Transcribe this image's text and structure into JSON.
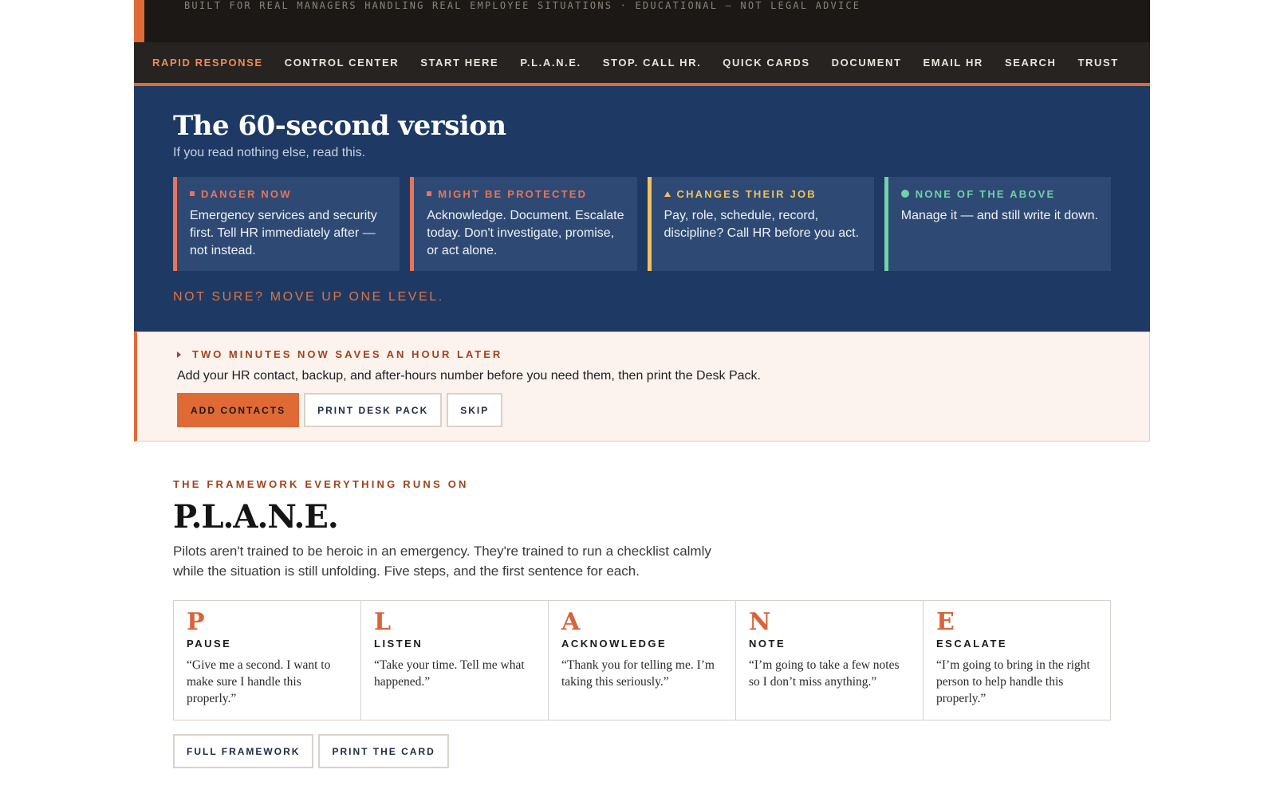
{
  "tagline": "BUILT FOR REAL MANAGERS HANDLING REAL EMPLOYEE SITUATIONS · EDUCATIONAL — NOT LEGAL ADVICE",
  "nav": {
    "items": [
      {
        "label": "RAPID RESPONSE",
        "active": true
      },
      {
        "label": "CONTROL CENTER"
      },
      {
        "label": "START HERE"
      },
      {
        "label": "P.L.A.N.E."
      },
      {
        "label": "STOP. CALL HR."
      },
      {
        "label": "QUICK CARDS"
      },
      {
        "label": "DOCUMENT"
      },
      {
        "label": "EMAIL HR"
      },
      {
        "label": "SEARCH"
      },
      {
        "label": "TRUST"
      }
    ]
  },
  "quick": {
    "title": "The 60-second version",
    "subtitle": "If you read nothing else, read this.",
    "cards": [
      {
        "label": "DANGER NOW",
        "body": "Emergency services and security first. Tell HR immediately after — not instead.",
        "color": "#e8745a",
        "marker": "square"
      },
      {
        "label": "MIGHT BE PROTECTED",
        "body": "Acknowledge. Document. Escalate today. Don't investigate, promise, or act alone.",
        "color": "#e8745a",
        "marker": "square"
      },
      {
        "label": "CHANGES THEIR JOB",
        "body": "Pay, role, schedule, record, discipline? Call HR before you act.",
        "color": "#f2c15e",
        "marker": "triangle"
      },
      {
        "label": "NONE OF THE ABOVE",
        "body": "Manage it — and still write it down.",
        "color": "#6fd3a6",
        "marker": "dot"
      }
    ],
    "footer": "NOT SURE? MOVE UP ONE LEVEL."
  },
  "callout": {
    "heading": "TWO MINUTES NOW SAVES AN HOUR LATER",
    "message": "Add your HR contact, backup, and after-hours number before you need them, then print the Desk Pack.",
    "buttons": {
      "add": "ADD CONTACTS",
      "print": "PRINT DESK PACK",
      "skip": "SKIP"
    }
  },
  "plane": {
    "eyebrow": "THE FRAMEWORK EVERYTHING RUNS ON",
    "title": "P.L.A.N.E.",
    "intro": "Pilots aren't trained to be heroic in an emergency. They're trained to run a checklist calmly while the situation is still unfolding. Five steps, and the first sentence for each.",
    "steps": [
      {
        "letter": "P",
        "word": "PAUSE",
        "quote": "“Give me a second. I want to make sure I handle this properly.”"
      },
      {
        "letter": "L",
        "word": "LISTEN",
        "quote": "“Take your time. Tell me what happened.”"
      },
      {
        "letter": "A",
        "word": "ACKNOWLEDGE",
        "quote": "“Thank you for telling me. I’m taking this seriously.”"
      },
      {
        "letter": "N",
        "word": "NOTE",
        "quote": "“I’m going to take a few notes so I don’t miss anything.”"
      },
      {
        "letter": "E",
        "word": "ESCALATE",
        "quote": "“I’m going to bring in the right person to help handle this properly.”"
      }
    ],
    "buttons": {
      "framework": "FULL FRAMEWORK",
      "print": "PRINT THE CARD"
    }
  }
}
